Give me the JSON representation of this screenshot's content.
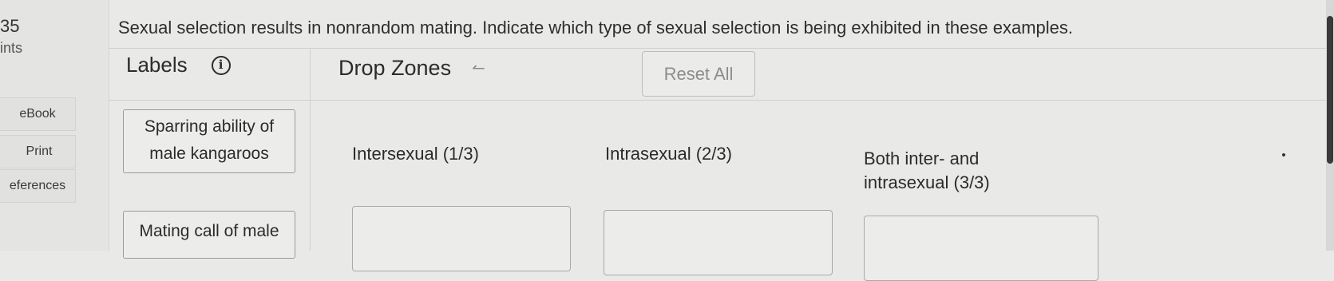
{
  "sidebar": {
    "question_number": "35",
    "points_label": "ints",
    "ebook_label": "eBook",
    "print_label": "Print",
    "references_label": "eferences"
  },
  "question": {
    "prompt": "Sexual selection results in nonrandom mating. Indicate which type of sexual selection is being exhibited in these examples."
  },
  "labels_panel": {
    "title": "Labels",
    "info_icon": "info-icon",
    "cards": [
      {
        "text_line1": "Sparring ability of",
        "text_line2": "male kangaroos"
      },
      {
        "text_line1": "Mating call of male"
      }
    ]
  },
  "drop_zones": {
    "title": "Drop Zones",
    "undo_icon": "undo-arrow-icon",
    "reset_label": "Reset All",
    "zones": [
      {
        "title": "Intersexual (1/3)"
      },
      {
        "title": "Intrasexual (2/3)"
      },
      {
        "title_line1": "Both inter- and",
        "title_line2": "intrasexual (3/3)"
      }
    ]
  },
  "colors": {
    "background": "#e9e9e7",
    "text": "#2b2b2b",
    "border": "#9a9a98",
    "muted": "#8c8c8c"
  }
}
